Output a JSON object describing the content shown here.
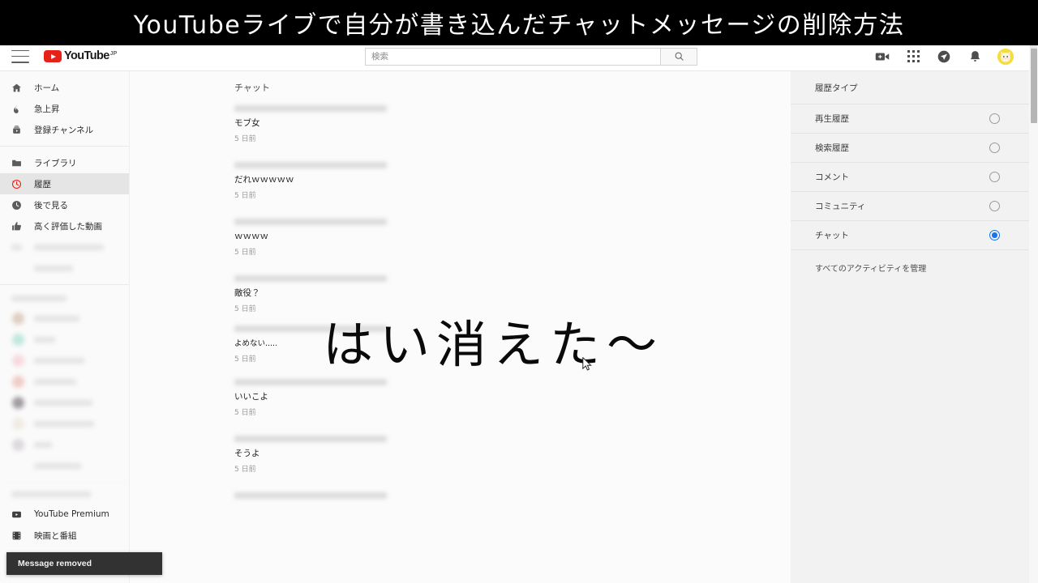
{
  "video_title_banner": "YouTubeライブで自分が書き込んだチャットメッセージの削除方法",
  "overlay": {
    "handwritten_text": "はい消えた〜",
    "cursor_icon": "mouse-pointer-icon"
  },
  "toast": {
    "message": "Message removed"
  },
  "masthead": {
    "menu_icon": "hamburger-menu-icon",
    "logo_text": "YouTube",
    "logo_country_code": "JP",
    "logo_icon": "youtube-play-icon",
    "search": {
      "placeholder": "検索",
      "value": "",
      "button_icon": "search-icon"
    },
    "icons": [
      {
        "name": "create-video-icon",
        "glyph": "video-camera-plus"
      },
      {
        "name": "youtube-apps-icon",
        "glyph": "grid-apps"
      },
      {
        "name": "messages-icon",
        "glyph": "chat-bubble"
      },
      {
        "name": "notifications-icon",
        "glyph": "bell"
      }
    ],
    "avatar": {
      "name": "user-avatar",
      "icon": "cat-avatar",
      "color": "#f7e14a"
    }
  },
  "sidebar": {
    "primary_items": [
      {
        "label": "ホーム",
        "icon": "home-icon",
        "active": false
      },
      {
        "label": "急上昇",
        "icon": "trending-flame-icon",
        "active": false
      },
      {
        "label": "登録チャンネル",
        "icon": "subscriptions-icon",
        "active": false
      }
    ],
    "library_items": [
      {
        "label": "ライブラリ",
        "icon": "library-folder-icon",
        "active": false
      },
      {
        "label": "履歴",
        "icon": "history-clock-icon",
        "active": true
      },
      {
        "label": "後で見る",
        "icon": "watch-later-clock-icon",
        "active": false
      },
      {
        "label": "高く評価した動画",
        "icon": "thumbs-up-icon",
        "active": false
      }
    ],
    "hidden_items_count": 2,
    "subscriptions_section_blurred": true,
    "subscription_avatar_colors": [
      "#c8ab92",
      "#8fd9c6",
      "#f4bfc9",
      "#e8a79a",
      "#565058",
      "#e8e0cf",
      "#c4bcc4"
    ],
    "subscriptions_count": 7,
    "more_items": [
      {
        "label": "YouTube Premium",
        "icon": "youtube-premium-icon"
      },
      {
        "label": "映画と番組",
        "icon": "movies-shows-icon"
      }
    ]
  },
  "main": {
    "section_heading": "チャット",
    "entries": [
      {
        "title_blurred": true,
        "message": "モブ女",
        "time": "5 日前"
      },
      {
        "title_blurred": true,
        "message": "だれｗｗｗｗｗ",
        "time": "5 日前"
      },
      {
        "title_blurred": true,
        "message": "ｗｗｗｗ",
        "time": "5 日前"
      },
      {
        "title_blurred": true,
        "message": "敵役？",
        "time": "5 日前"
      },
      {
        "title_blurred": true,
        "message": "よめない.....",
        "time": "5 日前"
      },
      {
        "title_blurred": true,
        "message": "いいこよ",
        "time": "5 日前"
      },
      {
        "title_blurred": true,
        "message": "そうよ",
        "time": "5 日前"
      },
      {
        "title_blurred": true,
        "message": "",
        "time": ""
      }
    ]
  },
  "right_panel": {
    "title": "履歴タイプ",
    "options": [
      {
        "label": "再生履歴",
        "selected": false
      },
      {
        "label": "検索履歴",
        "selected": false
      },
      {
        "label": "コメント",
        "selected": false
      },
      {
        "label": "コミュニティ",
        "selected": false
      },
      {
        "label": "チャット",
        "selected": true
      }
    ],
    "manage_link": "すべてのアクティビティを管理",
    "selected_color": "#1a73e8"
  },
  "scrollbar": {
    "position_pct": 4
  }
}
